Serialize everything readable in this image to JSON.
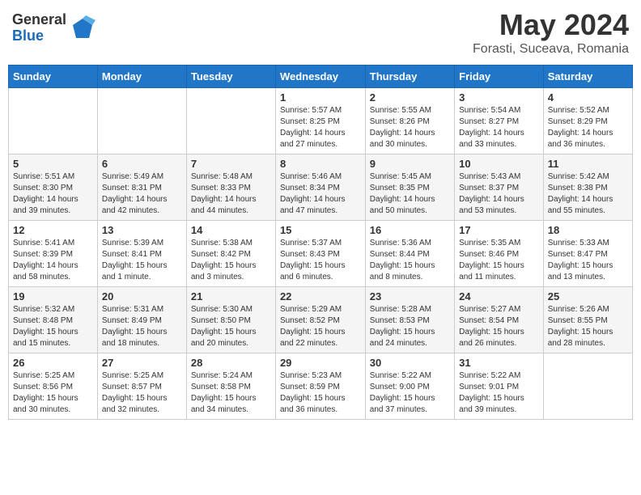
{
  "header": {
    "logo": {
      "general": "General",
      "blue": "Blue"
    },
    "title": "May 2024",
    "location": "Forasti, Suceava, Romania"
  },
  "calendar": {
    "weekdays": [
      "Sunday",
      "Monday",
      "Tuesday",
      "Wednesday",
      "Thursday",
      "Friday",
      "Saturday"
    ],
    "weeks": [
      [
        {
          "day": "",
          "info": ""
        },
        {
          "day": "",
          "info": ""
        },
        {
          "day": "",
          "info": ""
        },
        {
          "day": "1",
          "info": "Sunrise: 5:57 AM\nSunset: 8:25 PM\nDaylight: 14 hours\nand 27 minutes."
        },
        {
          "day": "2",
          "info": "Sunrise: 5:55 AM\nSunset: 8:26 PM\nDaylight: 14 hours\nand 30 minutes."
        },
        {
          "day": "3",
          "info": "Sunrise: 5:54 AM\nSunset: 8:27 PM\nDaylight: 14 hours\nand 33 minutes."
        },
        {
          "day": "4",
          "info": "Sunrise: 5:52 AM\nSunset: 8:29 PM\nDaylight: 14 hours\nand 36 minutes."
        }
      ],
      [
        {
          "day": "5",
          "info": "Sunrise: 5:51 AM\nSunset: 8:30 PM\nDaylight: 14 hours\nand 39 minutes."
        },
        {
          "day": "6",
          "info": "Sunrise: 5:49 AM\nSunset: 8:31 PM\nDaylight: 14 hours\nand 42 minutes."
        },
        {
          "day": "7",
          "info": "Sunrise: 5:48 AM\nSunset: 8:33 PM\nDaylight: 14 hours\nand 44 minutes."
        },
        {
          "day": "8",
          "info": "Sunrise: 5:46 AM\nSunset: 8:34 PM\nDaylight: 14 hours\nand 47 minutes."
        },
        {
          "day": "9",
          "info": "Sunrise: 5:45 AM\nSunset: 8:35 PM\nDaylight: 14 hours\nand 50 minutes."
        },
        {
          "day": "10",
          "info": "Sunrise: 5:43 AM\nSunset: 8:37 PM\nDaylight: 14 hours\nand 53 minutes."
        },
        {
          "day": "11",
          "info": "Sunrise: 5:42 AM\nSunset: 8:38 PM\nDaylight: 14 hours\nand 55 minutes."
        }
      ],
      [
        {
          "day": "12",
          "info": "Sunrise: 5:41 AM\nSunset: 8:39 PM\nDaylight: 14 hours\nand 58 minutes."
        },
        {
          "day": "13",
          "info": "Sunrise: 5:39 AM\nSunset: 8:41 PM\nDaylight: 15 hours\nand 1 minute."
        },
        {
          "day": "14",
          "info": "Sunrise: 5:38 AM\nSunset: 8:42 PM\nDaylight: 15 hours\nand 3 minutes."
        },
        {
          "day": "15",
          "info": "Sunrise: 5:37 AM\nSunset: 8:43 PM\nDaylight: 15 hours\nand 6 minutes."
        },
        {
          "day": "16",
          "info": "Sunrise: 5:36 AM\nSunset: 8:44 PM\nDaylight: 15 hours\nand 8 minutes."
        },
        {
          "day": "17",
          "info": "Sunrise: 5:35 AM\nSunset: 8:46 PM\nDaylight: 15 hours\nand 11 minutes."
        },
        {
          "day": "18",
          "info": "Sunrise: 5:33 AM\nSunset: 8:47 PM\nDaylight: 15 hours\nand 13 minutes."
        }
      ],
      [
        {
          "day": "19",
          "info": "Sunrise: 5:32 AM\nSunset: 8:48 PM\nDaylight: 15 hours\nand 15 minutes."
        },
        {
          "day": "20",
          "info": "Sunrise: 5:31 AM\nSunset: 8:49 PM\nDaylight: 15 hours\nand 18 minutes."
        },
        {
          "day": "21",
          "info": "Sunrise: 5:30 AM\nSunset: 8:50 PM\nDaylight: 15 hours\nand 20 minutes."
        },
        {
          "day": "22",
          "info": "Sunrise: 5:29 AM\nSunset: 8:52 PM\nDaylight: 15 hours\nand 22 minutes."
        },
        {
          "day": "23",
          "info": "Sunrise: 5:28 AM\nSunset: 8:53 PM\nDaylight: 15 hours\nand 24 minutes."
        },
        {
          "day": "24",
          "info": "Sunrise: 5:27 AM\nSunset: 8:54 PM\nDaylight: 15 hours\nand 26 minutes."
        },
        {
          "day": "25",
          "info": "Sunrise: 5:26 AM\nSunset: 8:55 PM\nDaylight: 15 hours\nand 28 minutes."
        }
      ],
      [
        {
          "day": "26",
          "info": "Sunrise: 5:25 AM\nSunset: 8:56 PM\nDaylight: 15 hours\nand 30 minutes."
        },
        {
          "day": "27",
          "info": "Sunrise: 5:25 AM\nSunset: 8:57 PM\nDaylight: 15 hours\nand 32 minutes."
        },
        {
          "day": "28",
          "info": "Sunrise: 5:24 AM\nSunset: 8:58 PM\nDaylight: 15 hours\nand 34 minutes."
        },
        {
          "day": "29",
          "info": "Sunrise: 5:23 AM\nSunset: 8:59 PM\nDaylight: 15 hours\nand 36 minutes."
        },
        {
          "day": "30",
          "info": "Sunrise: 5:22 AM\nSunset: 9:00 PM\nDaylight: 15 hours\nand 37 minutes."
        },
        {
          "day": "31",
          "info": "Sunrise: 5:22 AM\nSunset: 9:01 PM\nDaylight: 15 hours\nand 39 minutes."
        },
        {
          "day": "",
          "info": ""
        }
      ]
    ]
  }
}
